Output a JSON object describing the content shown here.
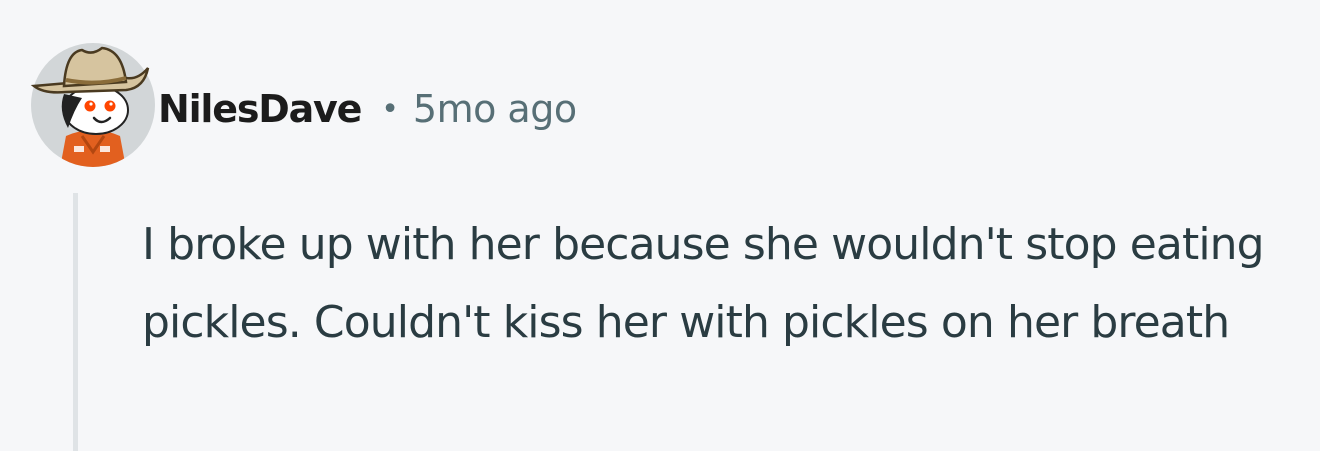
{
  "comment": {
    "author": "NilesDave",
    "separator": "•",
    "timestamp": "5mo ago",
    "avatar_icon": "cowboy-snoo-avatar-icon",
    "body": "I broke up with her because she wouldn't stop eating pickles. Couldn't kiss her with pickles on her breath"
  },
  "colors": {
    "background": "#f6f7f9",
    "username": "#1c1c1c",
    "meta": "#576f76",
    "body_text": "#2a3c42",
    "thread_line": "#dfe3e6",
    "avatar_accent": "#ff4500"
  }
}
